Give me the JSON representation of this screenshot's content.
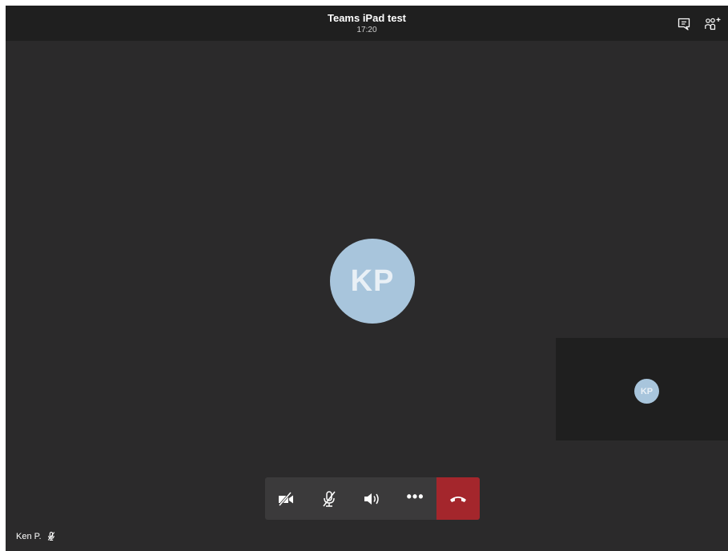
{
  "header": {
    "title": "Teams iPad test",
    "time": "17:20"
  },
  "top_icons": [
    "chat-icon",
    "people-add-icon"
  ],
  "main_participant": {
    "initials": "KP"
  },
  "self_view": {
    "initials": "KP"
  },
  "controls": {
    "items": [
      "video-off-icon",
      "mic-off-icon",
      "speaker-icon",
      "more-icon",
      "hang-up-icon"
    ],
    "more_label": "•••",
    "hangup_color": "#a4262c"
  },
  "name_tag": {
    "name": "Ken P.",
    "muted_icon": "mic-off-icon"
  },
  "colors": {
    "background": "#2b2a2b",
    "bar": "#1f1f1f",
    "avatar": "#a8c5dc"
  }
}
